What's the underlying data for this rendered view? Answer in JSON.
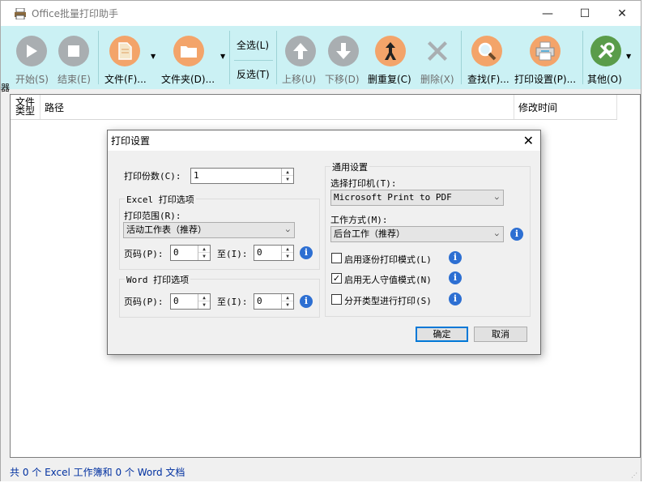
{
  "app": {
    "title": "Office批量打印助手"
  },
  "window_controls": {
    "minimize": "—",
    "maximize": "☐",
    "close": "✕"
  },
  "toolbar": {
    "side_glyph": "器",
    "start": "开始(S)",
    "stop": "结束(E)",
    "file": "文件(F)...",
    "folder": "文件夹(D)...",
    "select_all": "全选(L)",
    "invert": "反选(T)",
    "move_up": "上移(U)",
    "move_down": "下移(D)",
    "dedupe": "删重复(C)",
    "delete": "删除(X)",
    "find": "查找(F)...",
    "print_settings": "打印设置(P)...",
    "other": "其他(O)",
    "dropdown_glyph": "▼"
  },
  "list": {
    "columns": {
      "type": "文件\n类型",
      "path": "路径",
      "modified": "修改时间"
    }
  },
  "status": {
    "text": "共 0 个 Excel 工作簿和 0 个 Word 文档"
  },
  "dialog": {
    "title": "打印设置",
    "close": "✕",
    "copies_label": "打印份数(C):",
    "copies_value": "1",
    "excel_group": "Excel 打印选项",
    "range_label": "打印范围(R):",
    "range_value": "活动工作表（推荐）",
    "excel_page_label": "页码(P):",
    "excel_page_from": "0",
    "excel_to_label": "至(I):",
    "excel_page_to": "0",
    "word_group": "Word 打印选项",
    "word_page_label": "页码(P):",
    "word_page_from": "0",
    "word_to_label": "至(I):",
    "word_page_to": "0",
    "general_group": "通用设置",
    "printer_label": "选择打印机(T):",
    "printer_value": "Microsoft Print to PDF",
    "mode_label": "工作方式(M):",
    "mode_value": "后台工作（推荐）",
    "opt_collate": "启用逐份打印模式(L)",
    "opt_unattended": "启用无人守值模式(N)",
    "opt_split": "分开类型进行打印(S)",
    "opt_unattended_checked": true,
    "ok": "确定",
    "cancel": "取消",
    "info_glyph": "i",
    "check_glyph": "✓"
  },
  "colors": {
    "toolbar_bg": "#cbf1f4",
    "orange": "#f3a46a",
    "gray": "#a9aeb1",
    "status_text": "#0030a0"
  }
}
